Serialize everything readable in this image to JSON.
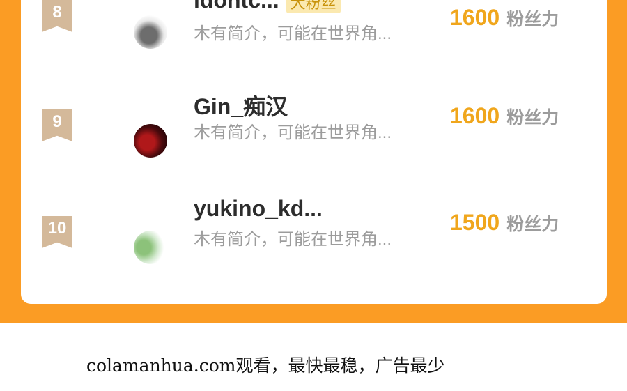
{
  "rows": [
    {
      "rank": "8",
      "name": "idontc...",
      "tag": "大粉丝",
      "bio": "木有简介，可能在世界角...",
      "score": "1600",
      "unit": "粉丝力"
    },
    {
      "rank": "9",
      "name": "Gin_痴汉",
      "tag": "",
      "bio": "木有简介，可能在世界角...",
      "score": "1600",
      "unit": "粉丝力"
    },
    {
      "rank": "10",
      "name": "yukino_kd...",
      "tag": "",
      "bio": "木有简介，可能在世界角...",
      "score": "1500",
      "unit": "粉丝力"
    }
  ],
  "footer": "colamanhua.com观看，最快最稳，广告最少",
  "colors": {
    "frame": "#fb9c24",
    "score": "#f0a61c",
    "badge": "#d4b99a"
  }
}
